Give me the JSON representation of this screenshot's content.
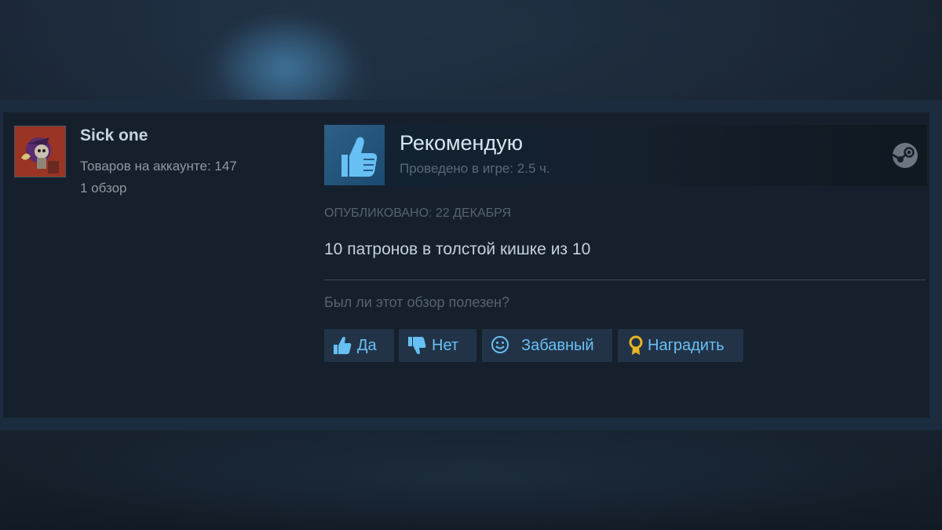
{
  "author": {
    "name": "Sick one",
    "products_text": "Товаров на аккаунте: 147",
    "reviews_text": "1 обзор"
  },
  "review": {
    "verdict": "Рекомендую",
    "hours_text": "Проведено в игре: 2.5 ч.",
    "posted_text": "ОПУБЛИКОВАНО: 22 ДЕКАБРЯ",
    "body": "10 патронов в толстой кишке из 10"
  },
  "feedback": {
    "question": "Был ли этот обзор полезен?",
    "buttons": {
      "yes": "Да",
      "no": "Нет",
      "funny": "Забавный",
      "award": "Наградить"
    }
  },
  "icons": {
    "verdict": "thumbs-up-icon",
    "platform": "steam-logo-icon",
    "yes": "thumbs-up-icon",
    "no": "thumbs-down-icon",
    "funny": "smiley-icon",
    "award": "award-ribbon-icon"
  },
  "colors": {
    "page_bg": "#1b2838",
    "card_bg": "#16202d",
    "link_blue": "#67c1f5",
    "verdict_icon_bg": "#2e5f86",
    "thumb_blue": "#66c0f4",
    "award_gold": "#e8b523"
  }
}
